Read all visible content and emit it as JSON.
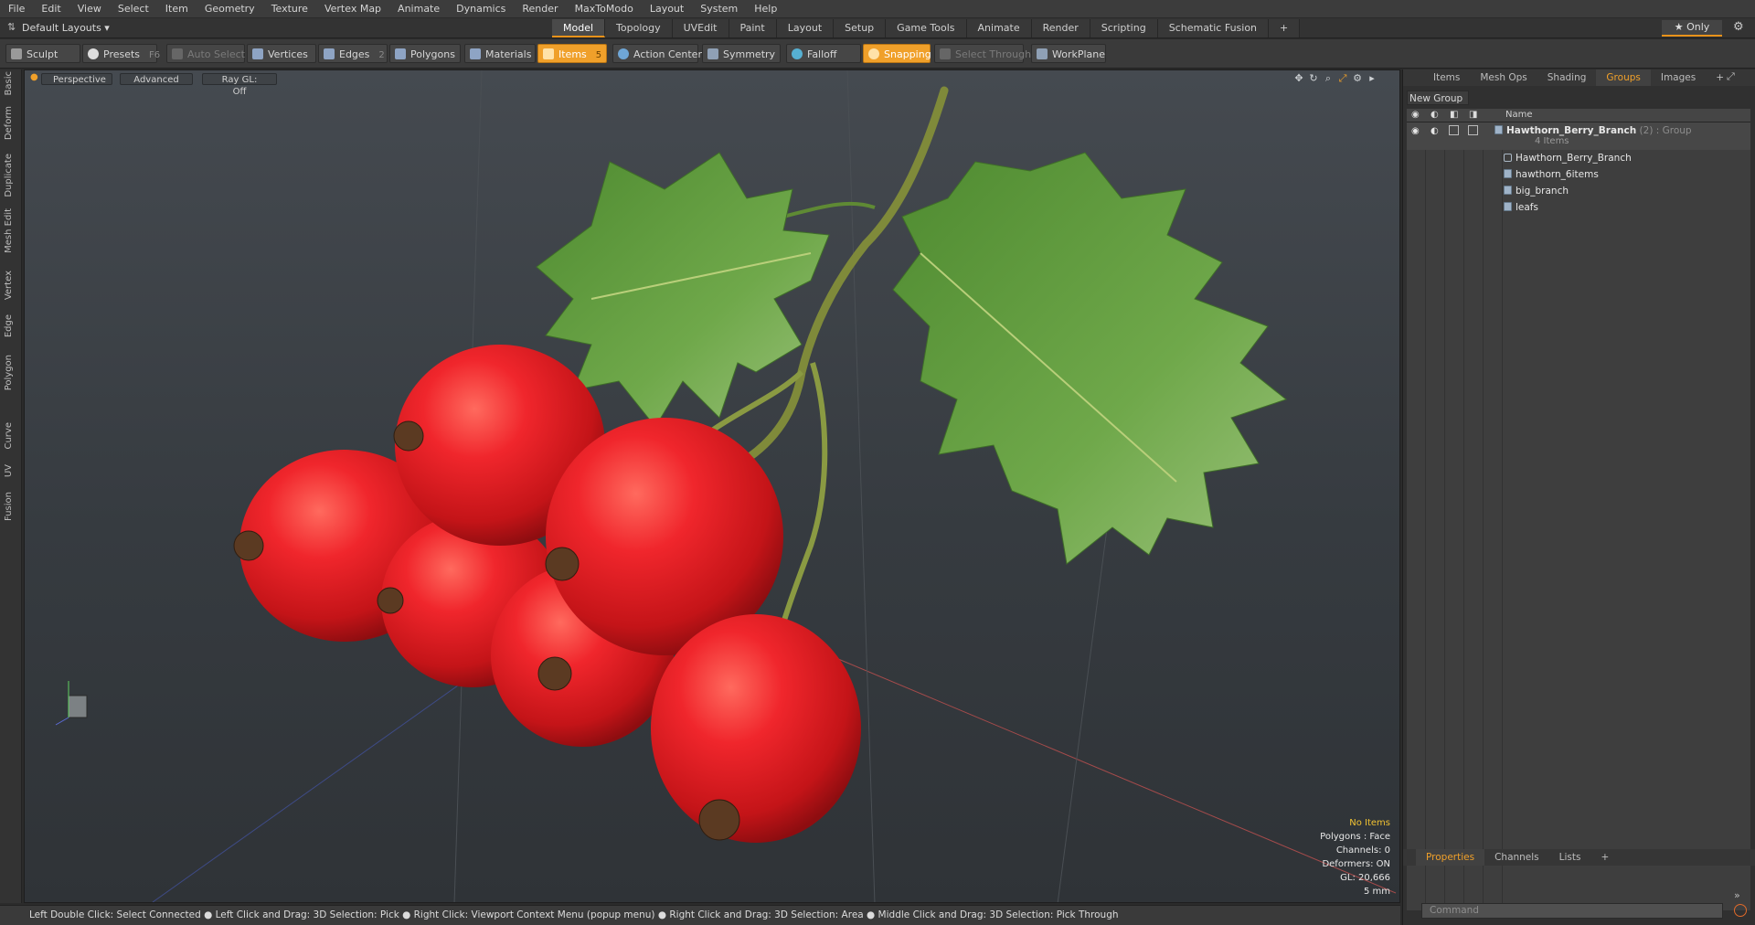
{
  "menu": [
    "File",
    "Edit",
    "View",
    "Select",
    "Item",
    "Geometry",
    "Texture",
    "Vertex Map",
    "Animate",
    "Dynamics",
    "Render",
    "MaxToModo",
    "Layout",
    "System",
    "Help"
  ],
  "layout_selector": "Default Layouts ▾",
  "layout_tabs": [
    "Model",
    "Topology",
    "UVEdit",
    "Paint",
    "Layout",
    "Setup",
    "Game Tools",
    "Animate",
    "Render",
    "Scripting",
    "Schematic Fusion",
    "+"
  ],
  "only_label": "★ Only",
  "toolbar": {
    "sculpt": "Sculpt",
    "presets": "Presets",
    "presets_key": "F6",
    "auto_select": "Auto Select",
    "vertices": "Vertices",
    "vertices_key": "1",
    "edges": "Edges",
    "edges_key": "2",
    "polygons": "Polygons",
    "materials": "Materials",
    "items": "Items",
    "items_key": "5",
    "action_center": "Action Center",
    "symmetry": "Symmetry",
    "falloff": "Falloff",
    "snapping": "Snapping",
    "select_through": "Select Through",
    "workplane": "WorkPlane"
  },
  "left_tabs": [
    "Basic",
    "Deform",
    "Duplicate",
    "Mesh Edit",
    "Vertex",
    "Edge",
    "Polygon",
    "Curve",
    "UV",
    "Fusion"
  ],
  "viewport": {
    "perspective": "Perspective",
    "advanced": "Advanced",
    "raygl": "Ray GL: Off"
  },
  "stats": {
    "no_items": "No Items",
    "polygons": "Polygons : Face",
    "channels": "Channels: 0",
    "deformers": "Deformers: ON",
    "gl": "GL: 20,666",
    "scale": "5 mm"
  },
  "status": "Left Double Click: Select Connected ● Left Click and Drag: 3D Selection: Pick ● Right Click: Viewport Context Menu (popup menu) ● Right Click and Drag: 3D Selection: Area ● Middle Click and Drag: 3D Selection: Pick Through",
  "right_tabs": [
    "Items",
    "Mesh Ops",
    "Shading",
    "Groups",
    "Images",
    "+"
  ],
  "new_group": "New Group",
  "list_header": "Name",
  "groups": {
    "root_name": "Hawthorn_Berry_Branch",
    "root_suffix": "(2) : Group",
    "root_count": "4 Items",
    "children": [
      "Hawthorn_Berry_Branch",
      "hawthorn_6items",
      "big_branch",
      "leafs"
    ]
  },
  "bottom_tabs": [
    "Properties",
    "Channels",
    "Lists",
    "+"
  ],
  "command_placeholder": "Command",
  "colors": {
    "accent": "#f0a02a",
    "berry": "#e3232a",
    "leaf": "#5d9a3c"
  }
}
